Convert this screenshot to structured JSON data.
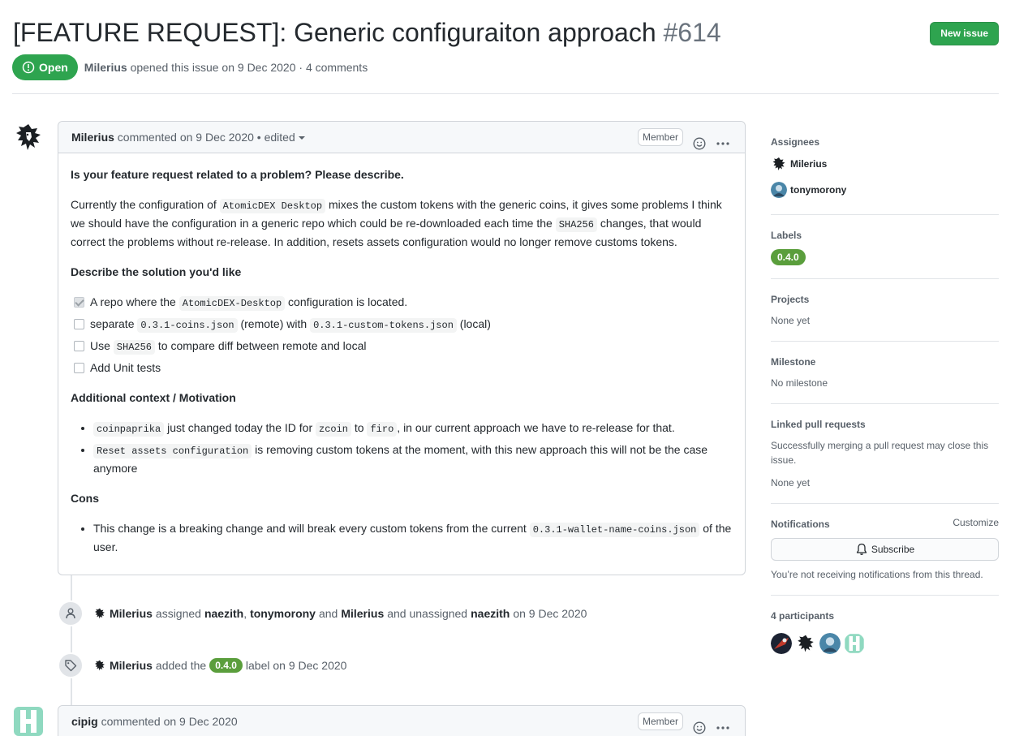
{
  "issue": {
    "title": "[FEATURE REQUEST]: Generic configuraiton approach",
    "number": "#614",
    "state": "Open",
    "author": "Milerius",
    "opened_text": "opened this issue on 9 Dec 2020 · 4 comments",
    "new_issue_label": "New issue"
  },
  "comment1": {
    "author": "Milerius",
    "meta": "commented on 9 Dec 2020 • edited",
    "role": "Member",
    "h1": "Is your feature request related to a problem? Please describe.",
    "p1_a": "Currently the configuration of ",
    "p1_code1": "AtomicDEX Desktop",
    "p1_b": " mixes the custom tokens with the generic coins, it gives some problems I think we should have the configuration in a generic repo which could be re-downloaded each time the ",
    "p1_code2": "SHA256",
    "p1_c": " changes, that would correct the problems without re-release. In addition, resets assets configuration would no longer remove customs tokens.",
    "h2": "Describe the solution you'd like",
    "t1_a": "A repo where the ",
    "t1_code": "AtomicDEX-Desktop",
    "t1_b": " configuration is located.",
    "t2_a": "separate ",
    "t2_code1": "0.3.1-coins.json",
    "t2_b": " (remote) with ",
    "t2_code2": "0.3.1-custom-tokens.json",
    "t2_c": " (local)",
    "t3_a": "Use ",
    "t3_code": "SHA256",
    "t3_b": " to compare diff between remote and local",
    "t4": "Add Unit tests",
    "h3": "Additional context / Motivation",
    "b1_code1": "coinpaprika",
    "b1_a": " just changed today the ID for ",
    "b1_code2": "zcoin",
    "b1_b": " to ",
    "b1_code3": "firo",
    "b1_c": ", in our current approach we have to re-release for that.",
    "b2_code": "Reset assets configuration",
    "b2_a": " is removing custom tokens at the moment, with this new approach this will not be the case anymore",
    "h4": "Cons",
    "c1_a": "This change is a breaking change and will break every custom tokens from the current ",
    "c1_code": "0.3.1-wallet-name-coins.json",
    "c1_b": " of the user."
  },
  "event1": {
    "actor": "Milerius",
    "verb1": "assigned",
    "user1": "naezith",
    "sep": ",",
    "user2": "tonymorony",
    "and1": "and",
    "user3": "Milerius",
    "verb2": "and unassigned",
    "user4": "naezith",
    "date": "on 9 Dec 2020"
  },
  "event2": {
    "actor": "Milerius",
    "verb": "added the",
    "label": "0.4.0",
    "suffix": "label on 9 Dec 2020"
  },
  "comment2": {
    "author": "cipig",
    "meta": "commented on 9 Dec 2020",
    "role": "Member"
  },
  "sidebar": {
    "assignees_heading": "Assignees",
    "assignee1": "Milerius",
    "assignee2": "tonymorony",
    "labels_heading": "Labels",
    "label1": "0.4.0",
    "projects_heading": "Projects",
    "projects_value": "None yet",
    "milestone_heading": "Milestone",
    "milestone_value": "No milestone",
    "linked_heading": "Linked pull requests",
    "linked_text": "Successfully merging a pull request may close this issue.",
    "linked_value": "None yet",
    "notifications_heading": "Notifications",
    "customize": "Customize",
    "subscribe": "Subscribe",
    "notifications_text": "You’re not receiving notifications from this thread.",
    "participants_heading": "4 participants"
  },
  "colors": {
    "open_green": "#2ea44f",
    "label_green": "#5a9e3c",
    "border": "#d1d5da"
  },
  "icons": [
    "issue-opened-icon",
    "kebab-horizontal-icon",
    "smiley-icon",
    "person-icon",
    "tag-icon",
    "bell-icon"
  ]
}
